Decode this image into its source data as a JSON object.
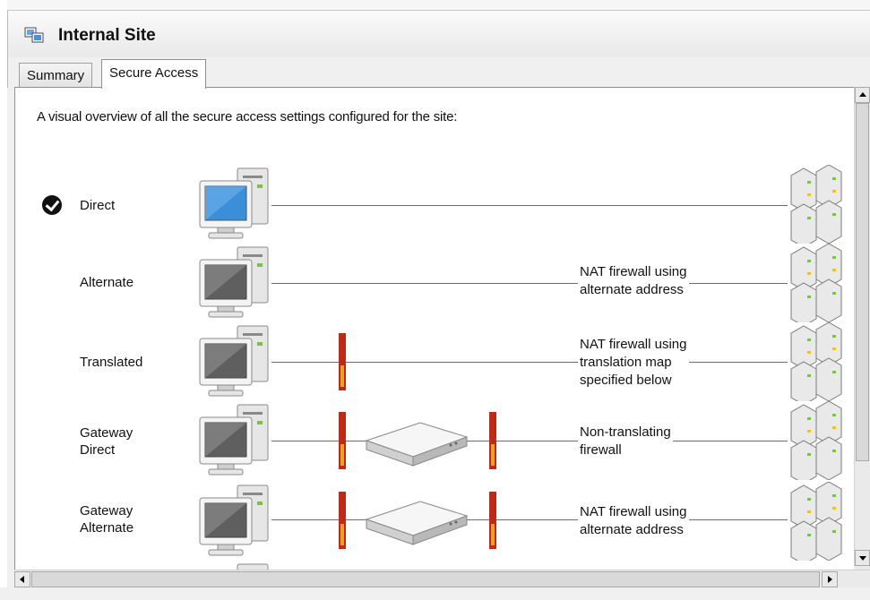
{
  "header": {
    "title": "Internal Site",
    "icon": "site-icon"
  },
  "tabs": [
    {
      "label": "Summary",
      "active": false
    },
    {
      "label": "Secure Access",
      "active": true
    }
  ],
  "intro": "A visual overview of all the secure access settings configured for the site:",
  "rows": [
    {
      "label": "Direct",
      "checked": true,
      "note": ""
    },
    {
      "label": "Alternate",
      "checked": false,
      "note_lines": [
        "NAT firewall using",
        "alternate address"
      ]
    },
    {
      "label": "Translated",
      "checked": false,
      "note_lines": [
        "NAT firewall using",
        "translation map",
        "specified below"
      ]
    },
    {
      "label_lines": [
        "Gateway",
        "Direct"
      ],
      "checked": false,
      "note_lines": [
        "Non-translating",
        "firewall"
      ]
    },
    {
      "label_lines": [
        "Gateway",
        "Alternate"
      ],
      "checked": false,
      "note_lines": [
        "NAT firewall using",
        "alternate address"
      ]
    }
  ],
  "icons": {
    "computer_active": "computer-monitor-icon",
    "computer_inactive": "computer-monitor-icon",
    "server": "server-stack-icon",
    "firewall": "firewall-icon",
    "gateway": "gateway-router-icon",
    "check": "checkmark-icon"
  },
  "colors": {
    "firewall_red": "#c0281a",
    "firewall_orange": "#f0a020",
    "screen_blue": "#3a8fd8",
    "line": "#6a6a6a"
  }
}
